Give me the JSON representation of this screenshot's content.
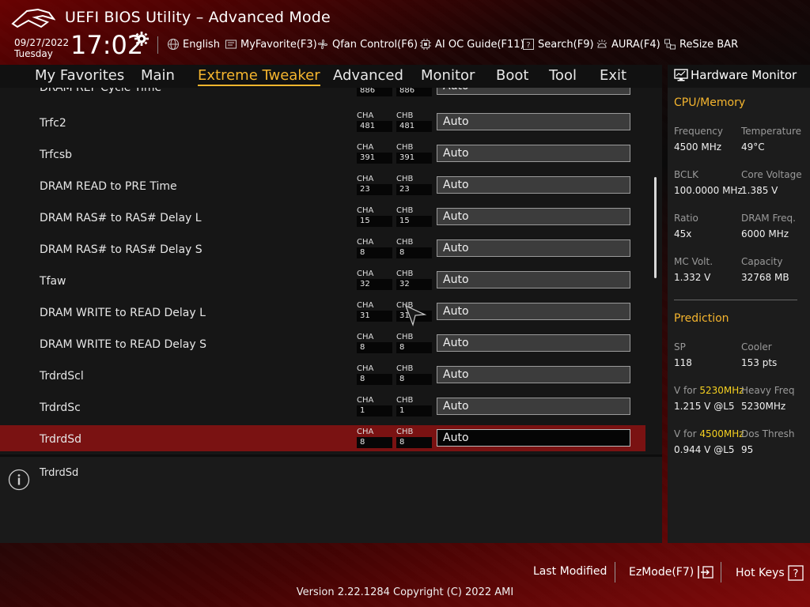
{
  "header": {
    "title": "UEFI BIOS Utility – Advanced Mode",
    "date": "09/27/2022",
    "day": "Tuesday",
    "time": "17:02",
    "items": [
      {
        "label": "English",
        "icon": "globe-icon"
      },
      {
        "label": "MyFavorite(F3)",
        "icon": "favorite-icon"
      },
      {
        "label": "Qfan Control(F6)",
        "icon": "fan-icon"
      },
      {
        "label": "AI OC Guide(F11)",
        "icon": "chip-icon"
      },
      {
        "label": "Search(F9)",
        "icon": "search-icon"
      },
      {
        "label": "AURA(F4)",
        "icon": "aura-icon"
      },
      {
        "label": "ReSize BAR",
        "icon": "resize-bar-icon"
      }
    ]
  },
  "menu": {
    "items": [
      "My Favorites",
      "Main",
      "Extreme Tweaker",
      "Advanced",
      "Monitor",
      "Boot",
      "Tool",
      "Exit"
    ],
    "active": "Extreme Tweaker"
  },
  "settings": {
    "channel_a_label": "CHA",
    "channel_b_label": "CHB",
    "rows": [
      {
        "label": "DRAM REF Cycle Time",
        "cha": "886",
        "chb": "886",
        "value": "Auto"
      },
      {
        "label": "Trfc2",
        "cha": "481",
        "chb": "481",
        "value": "Auto"
      },
      {
        "label": "Trfcsb",
        "cha": "391",
        "chb": "391",
        "value": "Auto"
      },
      {
        "label": "DRAM READ to PRE Time",
        "cha": "23",
        "chb": "23",
        "value": "Auto"
      },
      {
        "label": "DRAM RAS# to RAS# Delay L",
        "cha": "15",
        "chb": "15",
        "value": "Auto"
      },
      {
        "label": "DRAM RAS# to RAS# Delay S",
        "cha": "8",
        "chb": "8",
        "value": "Auto"
      },
      {
        "label": "Tfaw",
        "cha": "32",
        "chb": "32",
        "value": "Auto"
      },
      {
        "label": "DRAM WRITE to READ Delay L",
        "cha": "31",
        "chb": "31",
        "value": "Auto"
      },
      {
        "label": "DRAM WRITE to READ Delay S",
        "cha": "8",
        "chb": "8",
        "value": "Auto"
      },
      {
        "label": "TrdrdScl",
        "cha": "8",
        "chb": "8",
        "value": "Auto"
      },
      {
        "label": "TrdrdSc",
        "cha": "1",
        "chb": "1",
        "value": "Auto"
      },
      {
        "label": "TrdrdSd",
        "cha": "8",
        "chb": "8",
        "value": "Auto"
      }
    ],
    "selected_index": 11
  },
  "help": {
    "text": "TrdrdSd"
  },
  "hardware_monitor": {
    "title": "Hardware Monitor",
    "cpu_memory": {
      "title": "CPU/Memory",
      "pairs": [
        {
          "label": "Frequency",
          "value": "4500 MHz"
        },
        {
          "label": "Temperature",
          "value": "49°C"
        },
        {
          "label": "BCLK",
          "value": "100.0000 MHz"
        },
        {
          "label": "Core Voltage",
          "value": "1.385 V"
        },
        {
          "label": "Ratio",
          "value": "45x"
        },
        {
          "label": "DRAM Freq.",
          "value": "6000 MHz"
        },
        {
          "label": "MC Volt.",
          "value": "1.332 V"
        },
        {
          "label": "Capacity",
          "value": "32768 MB"
        }
      ]
    },
    "prediction": {
      "title": "Prediction",
      "sp_label": "SP",
      "sp_value": "118",
      "cooler_label": "Cooler",
      "cooler_value": "153 pts",
      "v1_label_prefix": "V for ",
      "v1_freq": "5230MHz",
      "v1_value": "1.215 V @L5",
      "heavy_freq_label": "Heavy Freq",
      "heavy_freq_value": "5230MHz",
      "v2_label_prefix": "V for ",
      "v2_freq": "4500MHz",
      "v2_value": "0.944 V @L5",
      "dos_thresh_label": "Dos Thresh",
      "dos_thresh_value": "95"
    }
  },
  "footer": {
    "last_modified": "Last Modified",
    "ezmode": "EzMode(F7)",
    "hot_keys": "Hot Keys",
    "version": "Version 2.22.1284 Copyright (C) 2022 AMI"
  },
  "colors": {
    "accent": "#f5b52e",
    "selected_row": "#7a1212",
    "highlight_freq": "#f5d020"
  }
}
